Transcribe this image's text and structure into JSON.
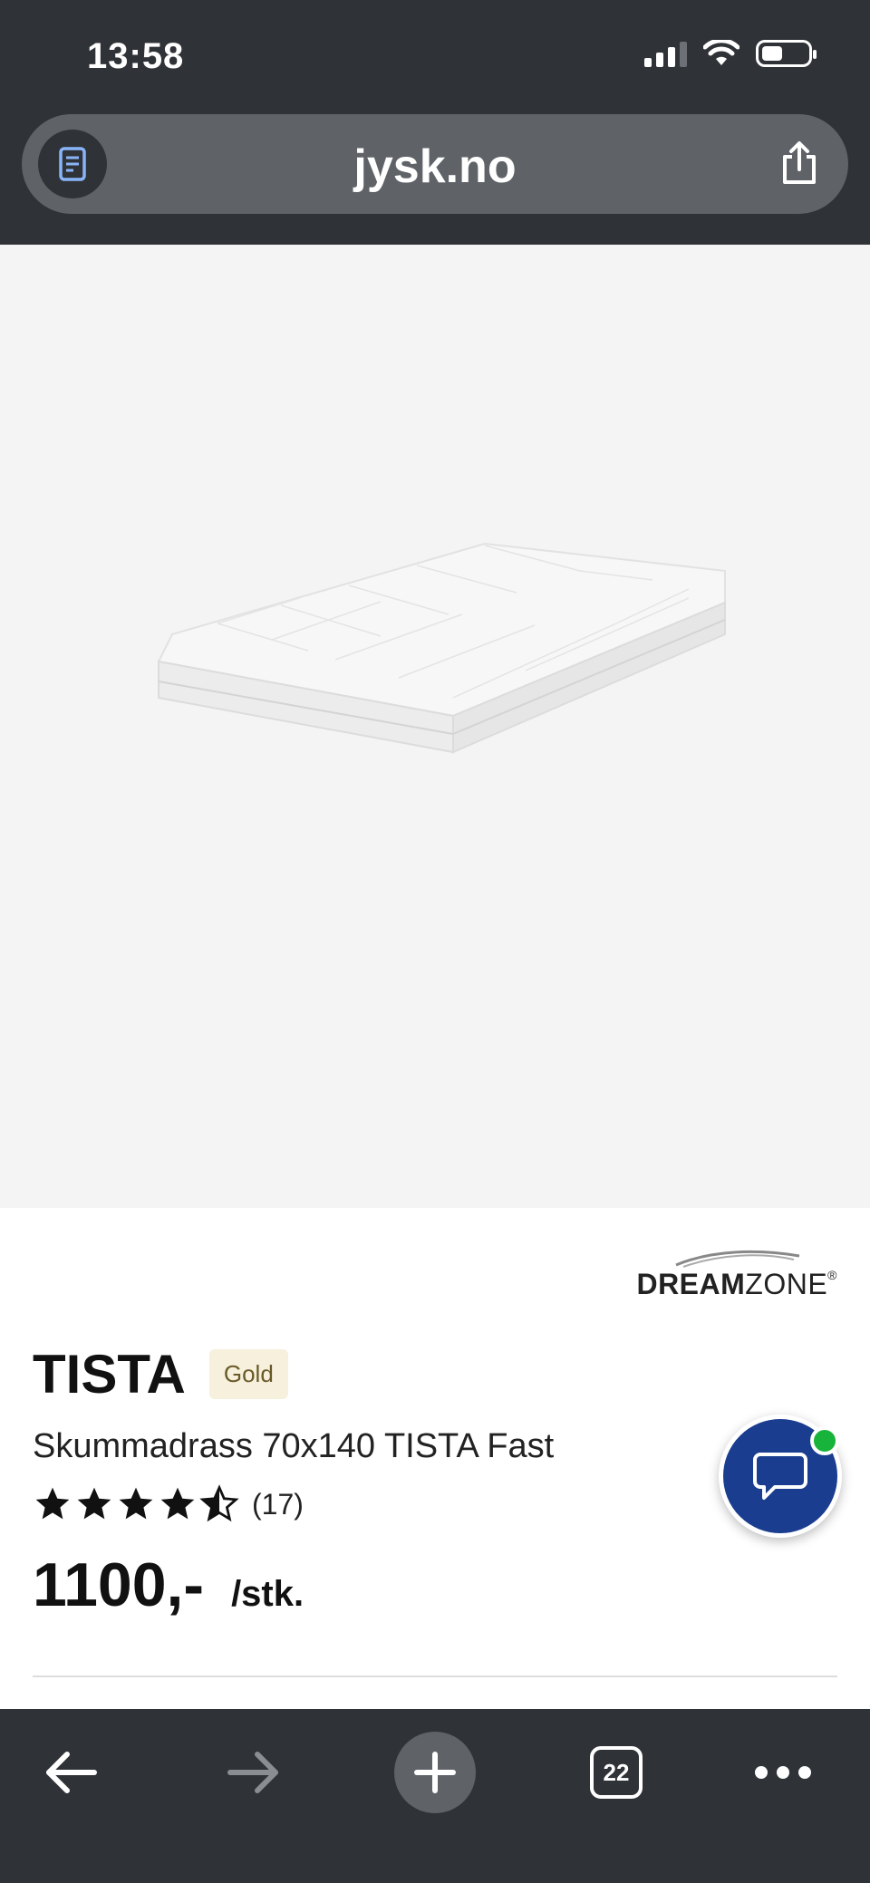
{
  "status_bar": {
    "time": "13:58",
    "icons": [
      "signal-icon",
      "wifi-icon",
      "battery-icon"
    ]
  },
  "browser": {
    "url": "jysk.no",
    "reader_icon": "reader-icon",
    "share_icon": "share-icon"
  },
  "product": {
    "image": "foam-mattress",
    "brand_prefix": "DREAM",
    "brand_suffix": "ZONE",
    "brand_mark": "®",
    "name": "TISTA",
    "badge": "Gold",
    "subtitle": "Skummadrass 70x140 TISTA Fast",
    "rating": 4.5,
    "rating_max": 5,
    "reviews": "(17)",
    "price": "1100,-",
    "unit": "/stk."
  },
  "chat": {
    "icon": "chat-bubble-icon",
    "online_color": "#18b33b",
    "color": "#1a3d8f"
  },
  "toolbar": {
    "tab_count": "22",
    "items": [
      "back-icon",
      "forward-icon",
      "new-tab-icon",
      "tabs-icon",
      "more-icon"
    ]
  },
  "colors": {
    "chrome": "#2f3236",
    "url_bar": "#5f6368",
    "image_bg": "#f4f4f4",
    "badge_bg": "#f6f0dc"
  }
}
